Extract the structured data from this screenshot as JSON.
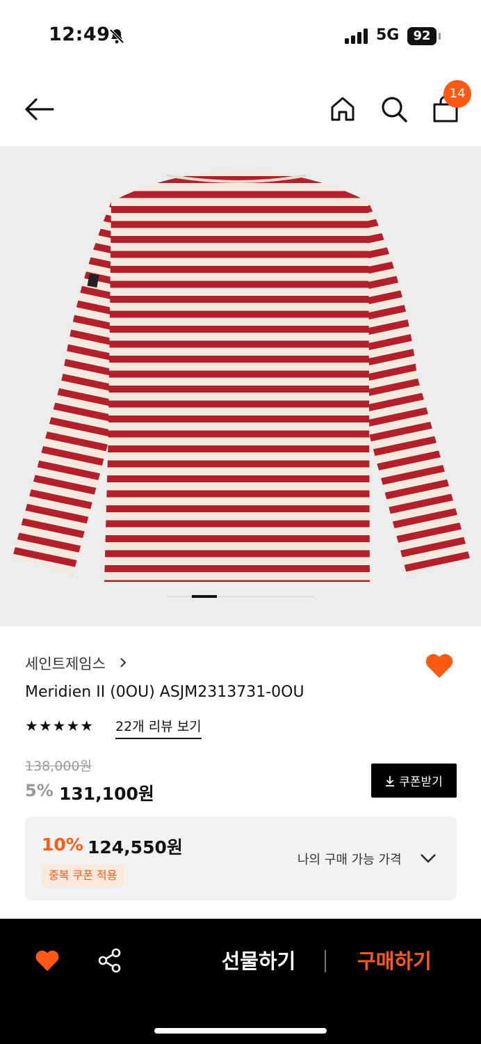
{
  "status_bar": {
    "time": "12:49",
    "network": "5G",
    "battery": "92",
    "icons": [
      "bell-slash-icon",
      "signal-icon"
    ]
  },
  "top_nav": {
    "icons": [
      "back-arrow-icon",
      "home-icon",
      "search-icon",
      "shopping-bag-icon"
    ],
    "cart_count": "14"
  },
  "gallery": {
    "image": "striped-long-sleeve-shirt",
    "colors": {
      "background": "#ededee",
      "stripe_red": "#b3202c",
      "stripe_cream": "#f3eadf"
    }
  },
  "product": {
    "brand": "세인트제임스",
    "name": "Meridien II (0OU) ASJM2313731-0OU",
    "stars": "★★★★★",
    "review_link": "22개 리뷰 보기"
  },
  "price": {
    "original": "138,000원",
    "discount_rate": "5%",
    "sale_price": "131,100원",
    "coupon_button": "쿠폰받기"
  },
  "my_price": {
    "rate": "10%",
    "price": "124,550원",
    "badge": "중복 쿠폰 적용",
    "label": "나의 구매 가능 가격"
  },
  "bottom_bar": {
    "gift_label": "선물하기",
    "buy_label": "구매하기",
    "accent": "#ff5a14"
  }
}
